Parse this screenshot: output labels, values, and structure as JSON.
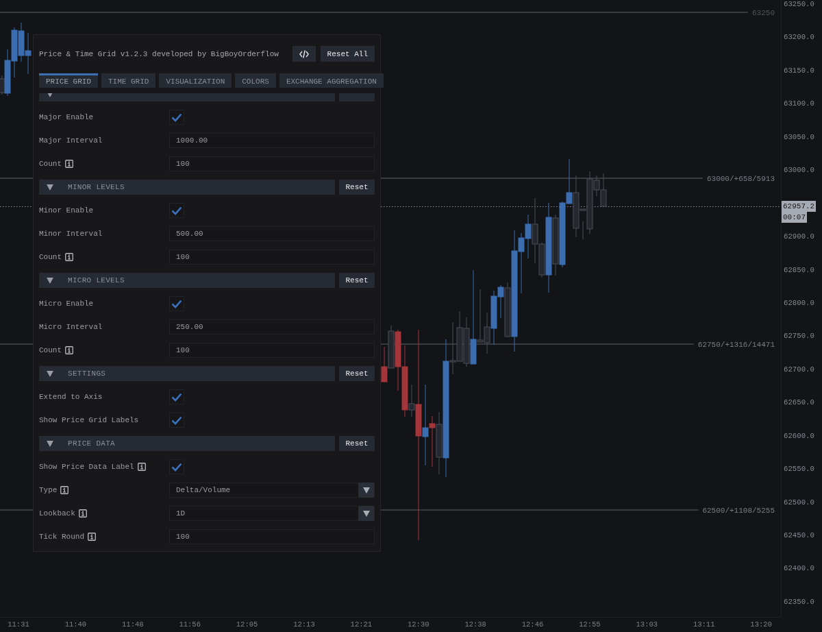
{
  "chart": {
    "grid_lines": [
      {
        "kind": "level",
        "label": "63250"
      },
      {
        "kind": "level",
        "label": "63000/+658/5913"
      },
      {
        "kind": "level",
        "label": "62750/+1316/14471"
      },
      {
        "kind": "level",
        "label": "62500/+1108/5255"
      }
    ],
    "price_axis": [
      "63250.0",
      "63200.0",
      "63150.0",
      "63100.0",
      "63050.0",
      "63000.0",
      "62900.0",
      "62850.0",
      "62800.0",
      "62750.0",
      "62700.0",
      "62650.0",
      "62600.0",
      "62550.0",
      "62500.0",
      "62450.0",
      "62400.0",
      "62350.0"
    ],
    "current_price": {
      "price": "62957.2",
      "countdown": "00:07"
    },
    "time_axis": [
      "11:31",
      "11:40",
      "11:48",
      "11:56",
      "12:05",
      "12:13",
      "12:21",
      "12:30",
      "12:38",
      "12:46",
      "12:55",
      "13:03",
      "13:11",
      "13:20"
    ]
  },
  "panel": {
    "title": "Price & Time Grid v1.2.3 developed by BigBoyOrderflow",
    "header_buttons": [
      {
        "kind": "code"
      },
      {
        "kind": "text",
        "label": "Reset All"
      }
    ],
    "tabs": [
      {
        "label": "PRICE GRID",
        "selected": true
      },
      {
        "label": "TIME GRID",
        "selected": false
      },
      {
        "label": "VISUALIZATION",
        "selected": false
      },
      {
        "label": "COLORS",
        "selected": false
      },
      {
        "label": "EXCHANGE AGGREGATION",
        "selected": false
      }
    ],
    "sections": [
      {
        "expanded": true,
        "rows": [
          {
            "kind": "checkbox",
            "label": "Major Enable",
            "checked": true
          },
          {
            "kind": "input",
            "label": "Major Interval",
            "value": "1000.00"
          },
          {
            "kind": "input",
            "label": "Count",
            "info": true,
            "value": "100"
          }
        ]
      },
      {
        "title": "MINOR LEVELS",
        "expanded": true,
        "reset": "Reset",
        "rows": [
          {
            "kind": "checkbox",
            "label": "Minor Enable",
            "checked": true
          },
          {
            "kind": "input",
            "label": "Minor Interval",
            "value": "500.00"
          },
          {
            "kind": "input",
            "label": "Count",
            "info": true,
            "value": "100"
          }
        ]
      },
      {
        "title": "MICRO LEVELS",
        "expanded": true,
        "reset": "Reset",
        "rows": [
          {
            "kind": "checkbox",
            "label": "Micro Enable",
            "checked": true
          },
          {
            "kind": "input",
            "label": "Micro Interval",
            "value": "250.00"
          },
          {
            "kind": "input",
            "label": "Count",
            "info": true,
            "value": "100"
          }
        ]
      },
      {
        "title": "SETTINGS",
        "expanded": true,
        "reset": "Reset",
        "rows": [
          {
            "kind": "checkbox",
            "label": "Extend to Axis",
            "checked": true
          },
          {
            "kind": "checkbox",
            "label": "Show Price Grid Labels",
            "checked": true
          }
        ]
      },
      {
        "title": "PRICE DATA",
        "expanded": true,
        "reset": "Reset",
        "rows": [
          {
            "kind": "checkbox",
            "label": "Show Price Data Label",
            "info": true,
            "checked": true
          },
          {
            "kind": "select",
            "label": "Type",
            "info": true,
            "value": "Delta/Volume"
          },
          {
            "kind": "select",
            "label": "Lookback",
            "info": true,
            "value": "1D"
          },
          {
            "kind": "input",
            "label": "Tick Round",
            "info": true,
            "value": "100"
          }
        ]
      }
    ]
  }
}
